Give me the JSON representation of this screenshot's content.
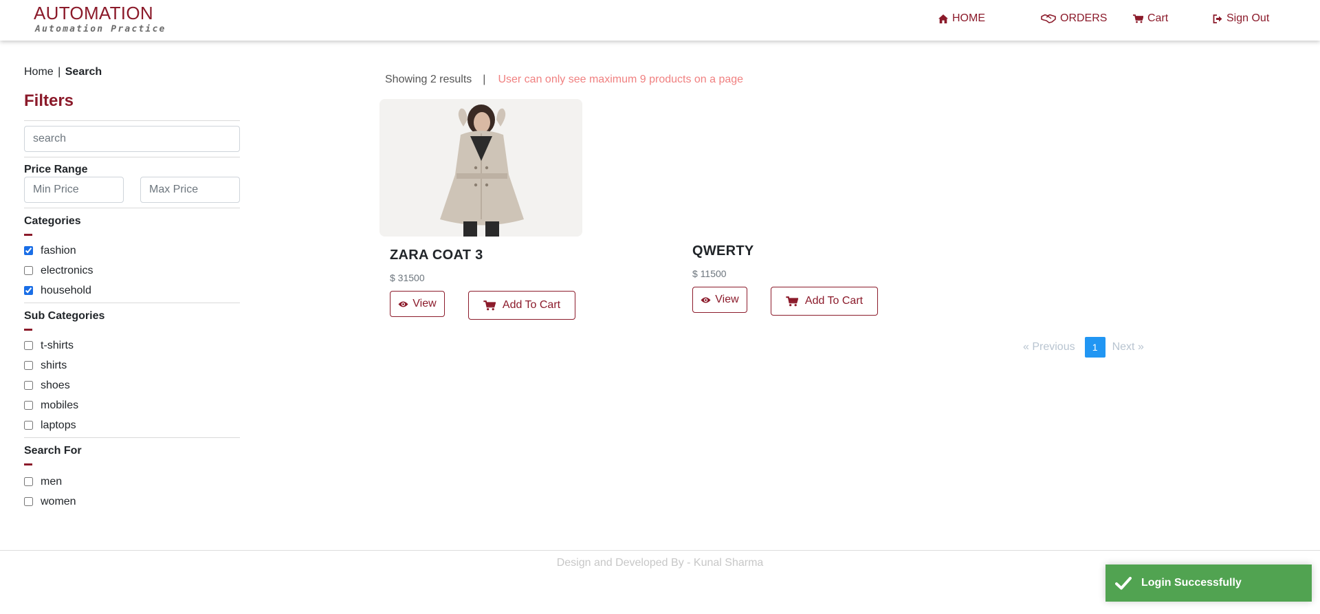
{
  "brand": {
    "title": "AUTOMATION",
    "subtitle": "Automation Practice"
  },
  "nav": {
    "home": "HOME",
    "orders": "ORDERS",
    "cart": "Cart",
    "sign_out": "Sign Out"
  },
  "breadcrumb": {
    "home": "Home",
    "separator": "|",
    "current": "Search"
  },
  "filters": {
    "title": "Filters",
    "search_placeholder": "search",
    "price_range_label": "Price Range",
    "min_price_placeholder": "Min Price",
    "max_price_placeholder": "Max Price",
    "categories_label": "Categories",
    "categories": [
      {
        "label": "fashion",
        "checked": true
      },
      {
        "label": "electronics",
        "checked": false
      },
      {
        "label": "household",
        "checked": true
      }
    ],
    "sub_categories_label": "Sub Categories",
    "sub_categories": [
      {
        "label": "t-shirts",
        "checked": false
      },
      {
        "label": "shirts",
        "checked": false
      },
      {
        "label": "shoes",
        "checked": false
      },
      {
        "label": "mobiles",
        "checked": false
      },
      {
        "label": "laptops",
        "checked": false
      }
    ],
    "search_for_label": "Search For",
    "search_for": [
      {
        "label": "men",
        "checked": false
      },
      {
        "label": "women",
        "checked": false
      }
    ]
  },
  "results": {
    "count_text": "Showing 2 results",
    "separator": "|",
    "limit_notice": "User can only see maximum 9 products on a page"
  },
  "products": [
    {
      "name": "ZARA COAT 3",
      "price": "$ 31500",
      "view_label": "View",
      "add_label": "Add To Cart",
      "has_image": true
    },
    {
      "name": "QWERTY",
      "price": "$ 11500",
      "view_label": "View",
      "add_label": "Add To Cart",
      "has_image": false
    }
  ],
  "pagination": {
    "prev": "«  Previous",
    "current": "1",
    "next": "Next  »"
  },
  "footer": {
    "text": "Design and Developed By - Kunal Sharma"
  },
  "toast": {
    "message": "Login Successfully"
  },
  "colors": {
    "brand": "#8b1a2a",
    "toast": "#51a351",
    "page_active": "#2196f3",
    "notice": "#f08080"
  },
  "icons": {
    "home": "home-icon",
    "orders": "handshake-icon",
    "cart": "cart-icon",
    "sign_out": "sign-out-icon",
    "view": "eye-icon",
    "add_to_cart": "cart-icon",
    "toast": "checkmark-icon"
  }
}
